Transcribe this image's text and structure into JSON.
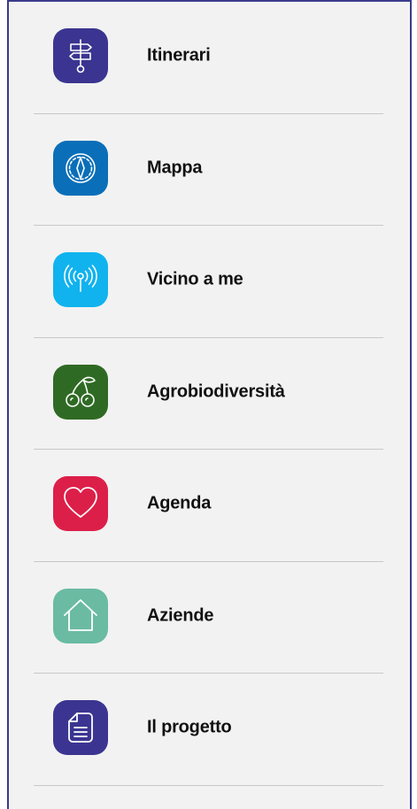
{
  "menu": {
    "items": [
      {
        "label": "Itinerari",
        "icon": "signpost-icon",
        "color": "#3b3591"
      },
      {
        "label": "Mappa",
        "icon": "compass-icon",
        "color": "#0a6fb8"
      },
      {
        "label": "Vicino a me",
        "icon": "broadcast-icon",
        "color": "#10b3ee"
      },
      {
        "label": "Agrobiodiversità",
        "icon": "cherries-icon",
        "color": "#2f6a24"
      },
      {
        "label": "Agenda",
        "icon": "heart-icon",
        "color": "#dc1f48"
      },
      {
        "label": "Aziende",
        "icon": "house-icon",
        "color": "#6abba2"
      },
      {
        "label": "Il progetto",
        "icon": "document-icon",
        "color": "#3b3591"
      }
    ]
  }
}
